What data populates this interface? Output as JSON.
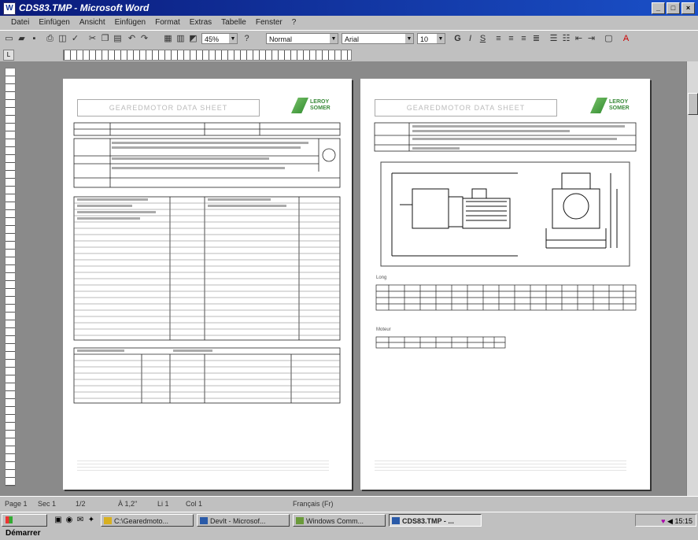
{
  "window": {
    "title": "CDS83.TMP - Microsoft Word",
    "controls": [
      "_",
      "□",
      "×"
    ]
  },
  "menu": [
    "Datei",
    "Einfügen",
    "Ansicht",
    "Einfügen",
    "Format",
    "Extras",
    "Tabelle",
    "Fenster",
    "?"
  ],
  "toolbar": {
    "zoom": "45%",
    "style": "Normal",
    "font": "Arial",
    "size": "10"
  },
  "document": {
    "page1_header": "GEAREDMOTOR DATA SHEET",
    "page2_header": "GEAREDMOTOR DATA SHEET",
    "logo_text": "LEROY\nSOMER",
    "page2_table1_title": "Long",
    "page2_table2_title": "Moteur"
  },
  "statusbar": {
    "page": "Page 1",
    "section": "Sec 1",
    "pages": "1/2",
    "at": "À 1,2\"",
    "line": "Li 1",
    "col": "Col 1",
    "lang": "Français (Fr)"
  },
  "taskbar": {
    "start": "Démarrer",
    "tasks": [
      "C:\\Gearedmoto...",
      "DevIt - Microsof...",
      "Windows Comm...",
      "CDS83.TMP - ..."
    ],
    "clock": "15:15"
  }
}
